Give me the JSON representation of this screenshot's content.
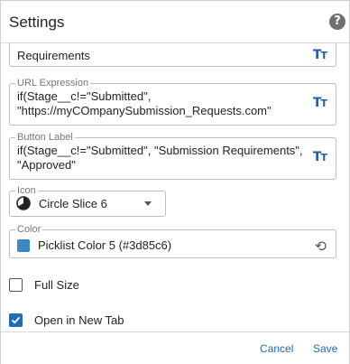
{
  "dialog": {
    "title": "Settings",
    "help_icon": "?"
  },
  "fields": {
    "requirements": {
      "value": "Requirements",
      "format_icon": "Tт"
    },
    "url_expression": {
      "label": "URL Expression",
      "line1": "if(Stage__c!=\"Submitted\",",
      "line2": "\"https://myCOmpanySubmission_Requests.com\"",
      "format_icon": "Tт"
    },
    "button_label": {
      "label": "Button Label",
      "line1": "if(Stage__c!=\"Submitted\", \"Submission Requirements\",",
      "line2": "\"Approved\"",
      "format_icon": "Tт"
    },
    "icon": {
      "label": "Icon",
      "value": "Circle Slice 6",
      "icon_name": "circle-slice-6-icon"
    },
    "color": {
      "label": "Color",
      "value": "Picklist Color 5 (#3d85c6)",
      "swatch": "#3d85c6"
    }
  },
  "options": {
    "full_size": {
      "label": "Full Size",
      "checked": false
    },
    "open_new_tab": {
      "label": "Open in New Tab",
      "checked": true
    }
  },
  "footer": {
    "cancel_label": "Cancel",
    "save_label": "Save"
  },
  "colors": {
    "accent": "#1f6bb5",
    "tt_icon": "#1f5fa3"
  }
}
